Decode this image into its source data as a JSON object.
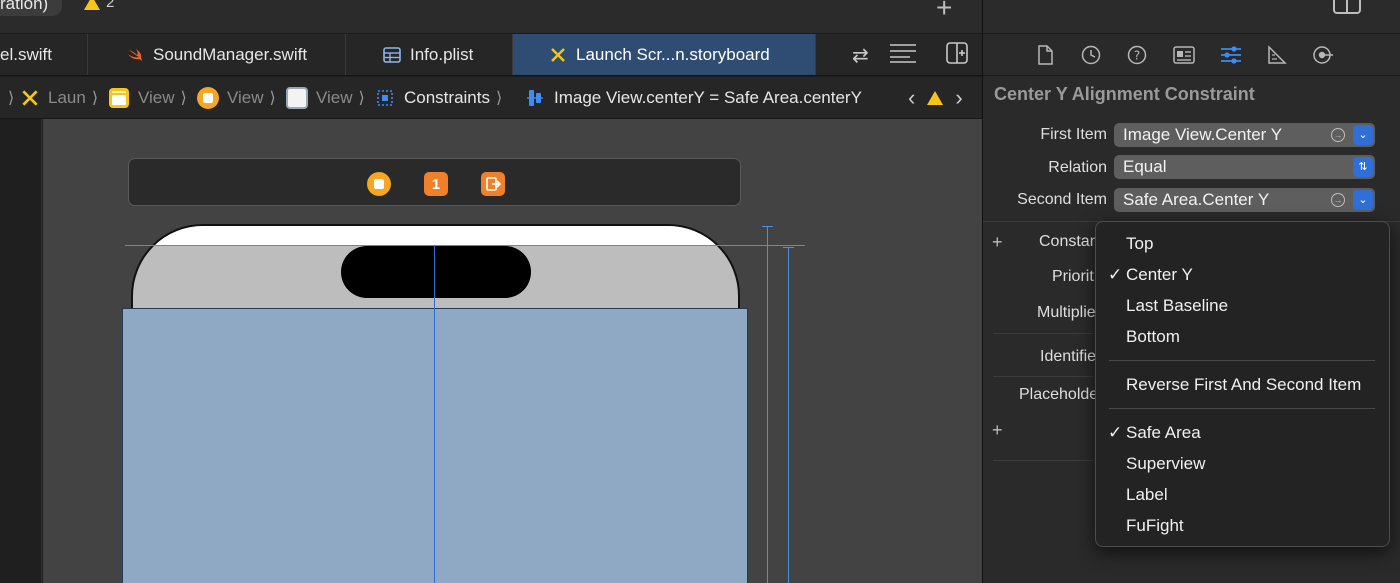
{
  "topbar": {
    "scheme_label": "ration)",
    "warning_count": "2"
  },
  "tabs": [
    {
      "label": "el.swift"
    },
    {
      "label": "SoundManager.swift"
    },
    {
      "label": "Info.plist"
    },
    {
      "label": "Launch Scr...n.storyboard",
      "active": true
    }
  ],
  "breadcrumb": [
    {
      "label": "Laun"
    },
    {
      "label": "View"
    },
    {
      "label": "View"
    },
    {
      "label": "View"
    },
    {
      "label": "Constraints"
    },
    {
      "label": "Image View.centerY = Safe Area.centerY"
    }
  ],
  "scene_dock": {
    "first_responder_badge": "1"
  },
  "inspector": {
    "title": "Center Y Alignment Constraint",
    "first_item_label": "First Item",
    "first_item_value": "Image View.Center Y",
    "relation_label": "Relation",
    "relation_value": "Equal",
    "second_item_label": "Second Item",
    "second_item_value": "Safe Area.Center Y",
    "constant_label": "Constan",
    "priority_label": "Priorit",
    "multiplier_label": "Multiplie",
    "identifier_label": "Identifie",
    "placeholder_label": "Placeholde"
  },
  "dropdown": {
    "items_group1": [
      {
        "label": "Top",
        "checked": false
      },
      {
        "label": "Center Y",
        "checked": true
      },
      {
        "label": "Last Baseline",
        "checked": false
      },
      {
        "label": "Bottom",
        "checked": false
      }
    ],
    "reverse_label": "Reverse First And Second Item",
    "items_group2": [
      {
        "label": "Safe Area",
        "checked": true
      },
      {
        "label": "Superview",
        "checked": false
      },
      {
        "label": "Label",
        "checked": false
      },
      {
        "label": "FuFight",
        "checked": false
      }
    ],
    "check_glyph": "✓"
  },
  "colors": {
    "accent": "#2f6fd6",
    "active_tab": "#2f4d73",
    "safe_area": "#8fa8c4",
    "guide": "#4a8fe0"
  },
  "icons": [
    "swift-icon",
    "table-icon",
    "storyboard-icon",
    "swap-icon",
    "lines-icon",
    "add-editor-icon",
    "file-icon",
    "history-icon",
    "help-icon",
    "identity-icon",
    "attributes-icon",
    "size-icon",
    "connections-icon",
    "warning-icon"
  ]
}
